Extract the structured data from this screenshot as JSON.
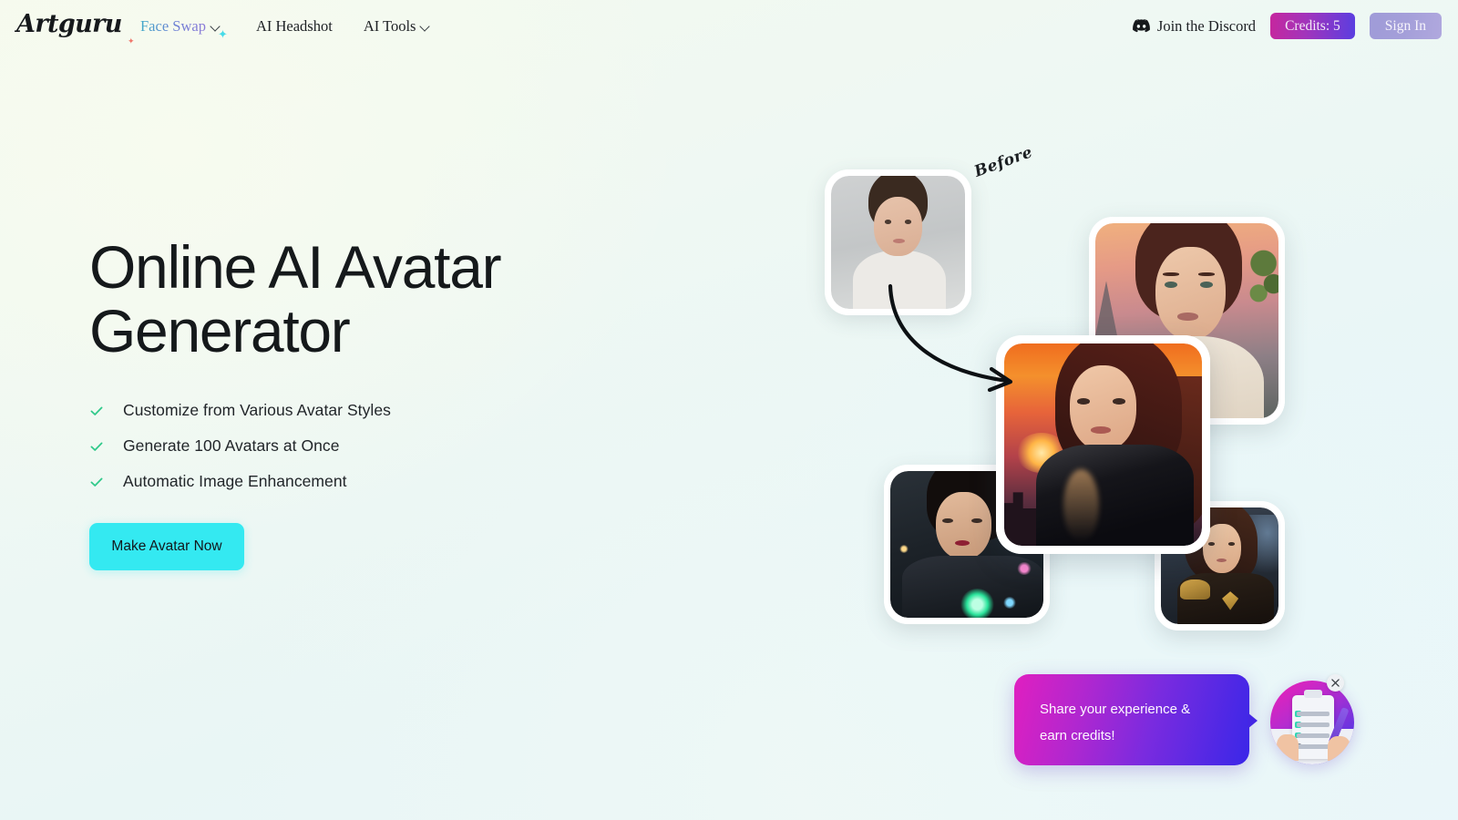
{
  "brand": {
    "name": "Artguru"
  },
  "nav": {
    "items": [
      {
        "label": "Face Swap",
        "has_dropdown": true,
        "gradient": true,
        "icon_left": "sparkle-icon",
        "icon_right": "sparkle-icon"
      },
      {
        "label": "AI Headshot",
        "has_dropdown": false
      },
      {
        "label": "AI Tools",
        "has_dropdown": true
      }
    ]
  },
  "header_right": {
    "discord_label": "Join the Discord",
    "discord_icon": "discord-icon",
    "credits_label": "Credits: 5",
    "credits_gradient_from": "#c5279e",
    "credits_gradient_to": "#5b3ee0",
    "signin_label": "Sign In",
    "signin_color": "#a49fd9"
  },
  "hero": {
    "title": "Online AI Avatar Generator",
    "features": [
      {
        "icon": "check-icon",
        "text": "Customize from Various Avatar Styles"
      },
      {
        "icon": "check-icon",
        "text": "Generate 100 Avatars at Once"
      },
      {
        "icon": "check-icon",
        "text": "Automatic Image Enhancement"
      }
    ],
    "check_color": "#2fc98a",
    "cta_label": "Make Avatar Now",
    "cta_color": "#34e9f1"
  },
  "collage": {
    "before_label": "Before",
    "arrow_icon": "curved-arrow-icon",
    "cards": [
      {
        "name": "before-photo",
        "alt": "Original portrait photo of a woman"
      },
      {
        "name": "avatar-sunset-mountain",
        "alt": "AI avatar with sunset mountain background"
      },
      {
        "name": "avatar-leather-sunset",
        "alt": "AI avatar in black leather with fiery sunset city"
      },
      {
        "name": "avatar-cyberpunk",
        "alt": "AI avatar in cyberpunk neon style"
      },
      {
        "name": "avatar-fantasy-warrior",
        "alt": "AI avatar in fantasy warrior armor"
      }
    ]
  },
  "survey": {
    "line1": "Share your experience &",
    "line2": "earn credits!",
    "badge_icon": "clipboard-survey-icon",
    "close_icon": "close-icon",
    "gradient_from": "#e01fc0",
    "gradient_to": "#3a27e8"
  }
}
